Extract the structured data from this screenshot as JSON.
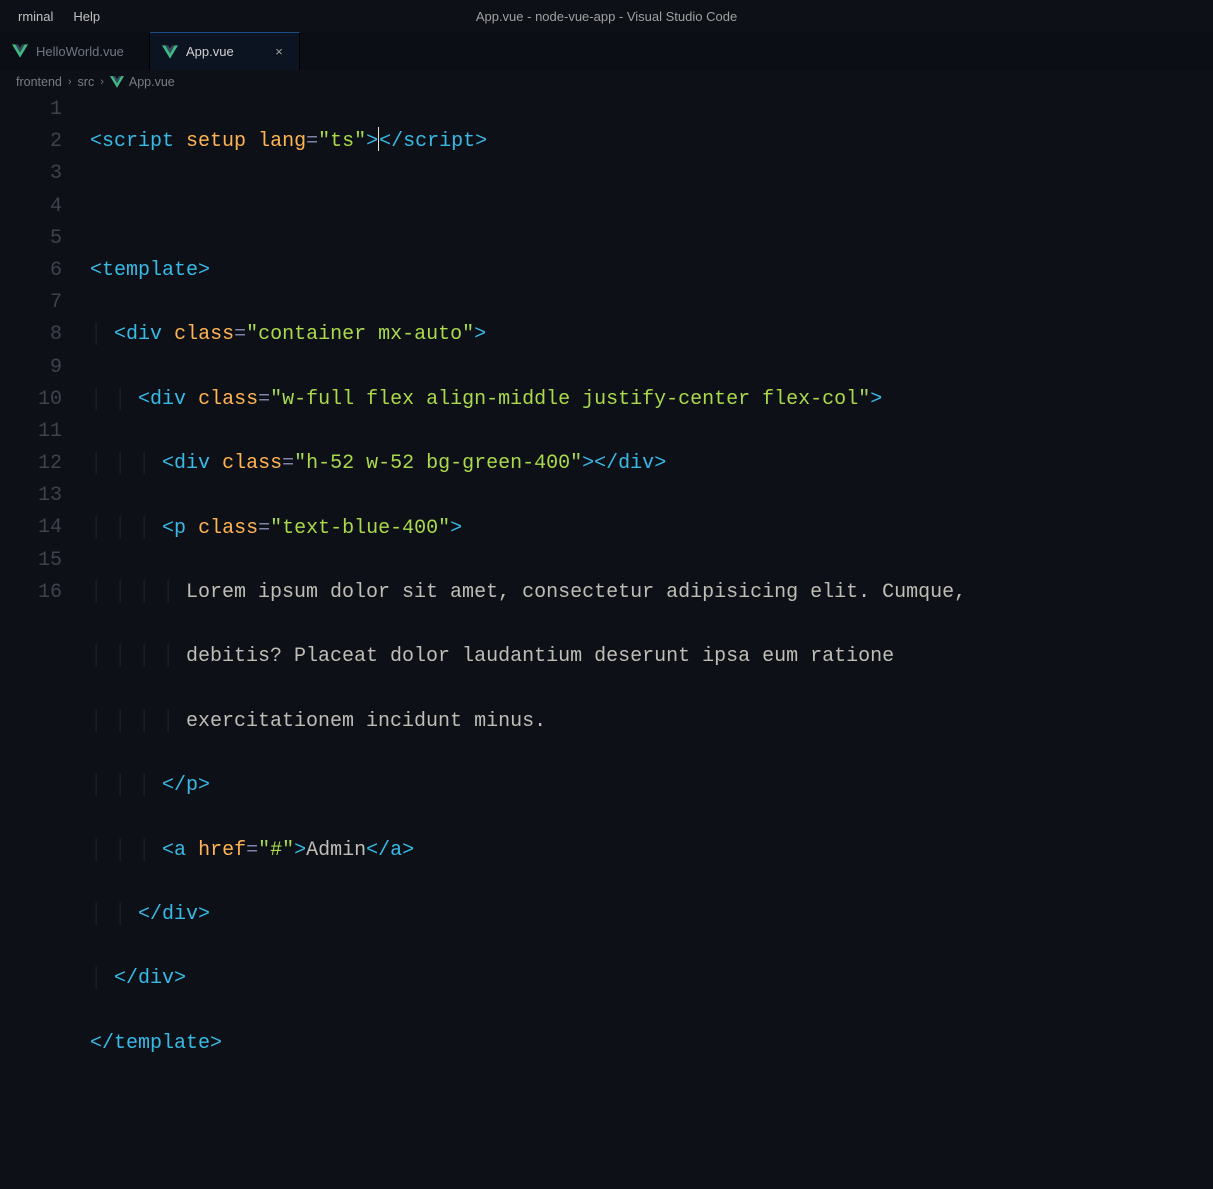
{
  "menubar": {
    "terminal": "rminal",
    "help": "Help"
  },
  "window_title": "App.vue - node-vue-app - Visual Studio Code",
  "tabs": [
    {
      "label": "HelloWorld.vue",
      "active": false
    },
    {
      "label": "App.vue",
      "active": true,
      "close": "×"
    }
  ],
  "breadcrumbs": {
    "frontend": "frontend",
    "src": "src",
    "file": "App.vue",
    "chev": "›"
  },
  "line_numbers": [
    "1",
    "2",
    "3",
    "4",
    "5",
    "6",
    "7",
    "8",
    "9",
    "10",
    "11",
    "12",
    "13",
    "14",
    "15",
    "16"
  ],
  "code": {
    "l1": {
      "o": "<",
      "t": "script",
      "a1": "setup",
      "a2": "lang",
      "eq": "=",
      "s": "\"ts\"",
      "c": ">",
      "co": "</",
      "t2": "script",
      "c2": ">"
    },
    "l3": {
      "o": "<",
      "t": "template",
      "c": ">"
    },
    "l4": {
      "o": "<",
      "t": "div",
      "a": "class",
      "eq": "=",
      "s": "\"container mx-auto\"",
      "c": ">"
    },
    "l5": {
      "o": "<",
      "t": "div",
      "a": "class",
      "eq": "=",
      "s": "\"w-full flex align-middle justify-center flex-col\"",
      "c": ">"
    },
    "l6": {
      "o": "<",
      "t": "div",
      "a": "class",
      "eq": "=",
      "s": "\"h-52 w-52 bg-green-400\"",
      "c": ">",
      "co": "</",
      "t2": "div",
      "c2": ">"
    },
    "l7": {
      "o": "<",
      "t": "p",
      "a": "class",
      "eq": "=",
      "s": "\"text-blue-400\"",
      "c": ">"
    },
    "l8": "Lorem ipsum dolor sit amet, consectetur adipisicing elit. Cumque,",
    "l9": "debitis? Placeat dolor laudantium deserunt ipsa eum ratione",
    "l10": "exercitationem incidunt minus.",
    "l11": {
      "co": "</",
      "t": "p",
      "c": ">"
    },
    "l12": {
      "o": "<",
      "t": "a",
      "a": "href",
      "eq": "=",
      "s": "\"#\"",
      "c": ">",
      "txt": "Admin",
      "co": "</",
      "t2": "a",
      "c2": ">"
    },
    "l13": {
      "co": "</",
      "t": "div",
      "c": ">"
    },
    "l14": {
      "co": "</",
      "t": "div",
      "c": ">"
    },
    "l15": {
      "co": "</",
      "t": "template",
      "c": ">"
    }
  }
}
